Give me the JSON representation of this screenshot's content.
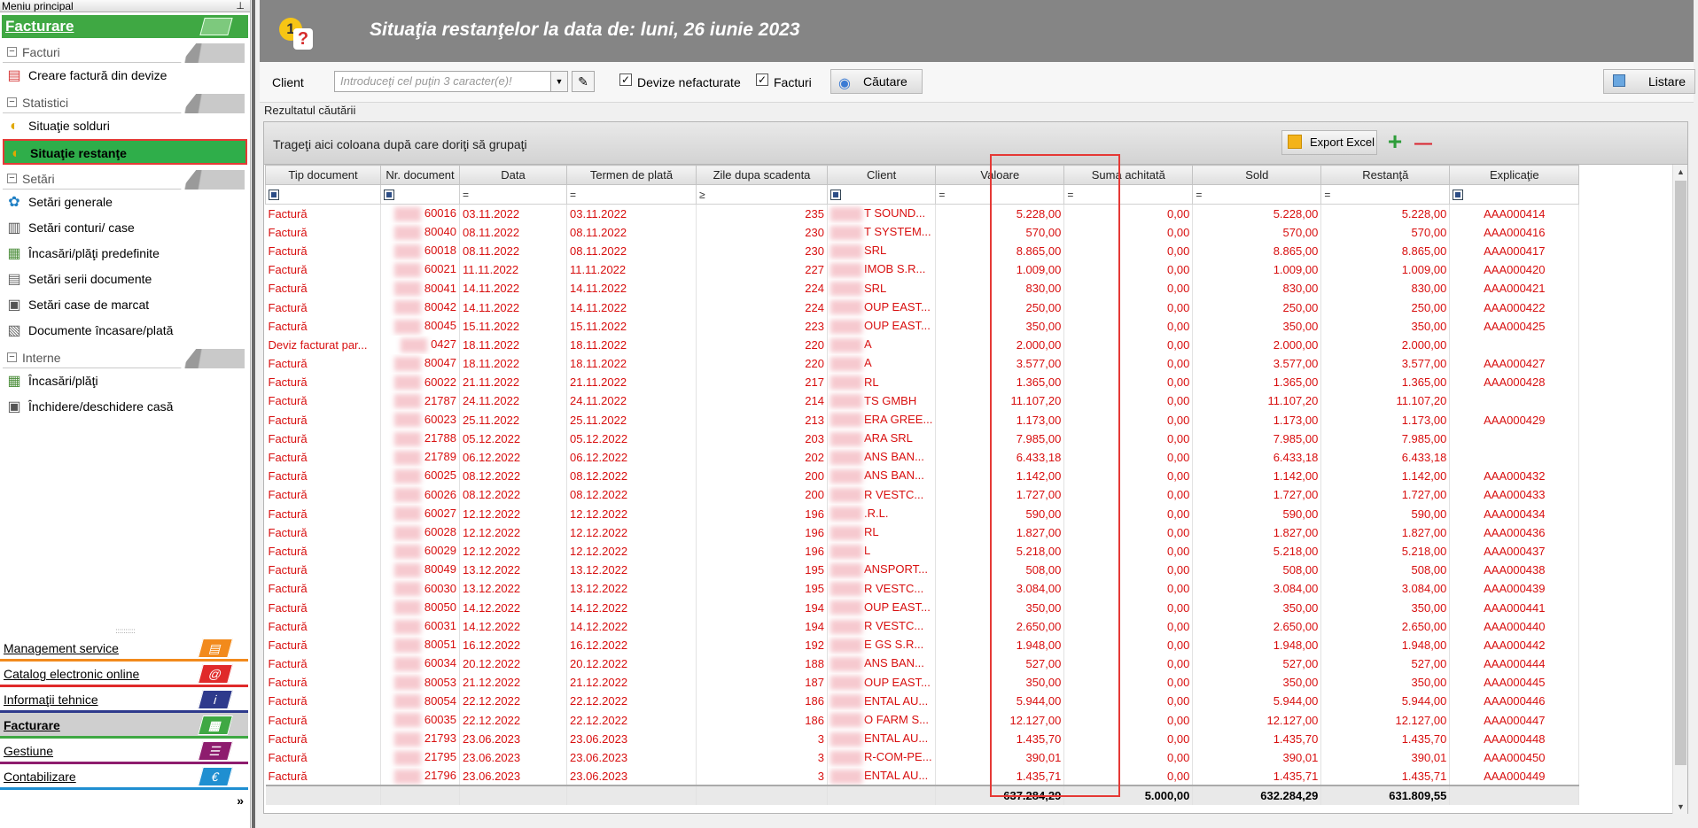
{
  "sidebar": {
    "top_title": "Meniu principal",
    "pin": "⊥",
    "active_module": "Facturare",
    "groups": [
      {
        "label": "Facturi",
        "items": [
          {
            "label": "Creare factură din devize",
            "icon": "invoice-icon"
          }
        ]
      },
      {
        "label": "Statistici",
        "items": [
          {
            "label": "Situaţie solduri",
            "icon": "chart-icon"
          },
          {
            "label": "Situaţie restanţe",
            "icon": "chart-icon",
            "selected": true
          }
        ]
      },
      {
        "label": "Setări",
        "items": [
          {
            "label": "Setări generale",
            "icon": "gear-icon"
          },
          {
            "label": "Setări conturi/ case",
            "icon": "accounts-icon"
          },
          {
            "label": "Încasări/plăţi predefinite",
            "icon": "payments-icon"
          },
          {
            "label": "Setări serii documente",
            "icon": "series-icon"
          },
          {
            "label": "Setări case de marcat",
            "icon": "register-icon"
          },
          {
            "label": "Documente încasare/plată",
            "icon": "document-icon"
          }
        ]
      },
      {
        "label": "Interne",
        "items": [
          {
            "label": "Încasări/plăţi",
            "icon": "payments-icon"
          },
          {
            "label": "Închidere/deschidere casă",
            "icon": "register-icon"
          }
        ]
      }
    ],
    "modules": [
      {
        "label": "Management service",
        "color": "#f28a1c",
        "glyph": "▤"
      },
      {
        "label": "Catalog electronic online",
        "color": "#e02a2a",
        "glyph": "@"
      },
      {
        "label": "Informaţii tehnice",
        "color": "#2e3a8c",
        "glyph": "i"
      },
      {
        "label": "Facturare",
        "color": "#3fa843",
        "glyph": "▦",
        "active": true
      },
      {
        "label": "Gestiune",
        "color": "#8e1c6e",
        "glyph": "☰"
      },
      {
        "label": "Contabilizare",
        "color": "#1f8fd1",
        "glyph": "€"
      }
    ],
    "footer": "»"
  },
  "header": {
    "title": "Situaţia restanţelor la data de: luni, 26 iunie 2023",
    "logo_text_1": "1",
    "logo_text_2": "?"
  },
  "toolbar": {
    "client_label": "Client",
    "client_placeholder": "Introduceţi cel puţin 3 caracter(e)!",
    "devize_label": "Devize nefacturate",
    "facturi_label": "Facturi",
    "search_label": "Căutare",
    "list_label": "Listare"
  },
  "results": {
    "label": "Rezultatul căutării",
    "group_hint": "Trageţi aici coloana după care doriţi să grupaţi",
    "export_label": "Export Excel",
    "add_glyph": "+",
    "remove_glyph": "—"
  },
  "columns": [
    "Tip document",
    "Nr. document",
    "Data",
    "Termen de plată",
    "Zile dupa scadenta",
    "Client",
    "Valoare",
    "Suma achitată",
    "Sold",
    "Restanţă",
    "Explicaţie"
  ],
  "filter_ops": [
    "",
    "",
    "=",
    "=",
    "≥",
    "",
    "=",
    "=",
    "=",
    "=",
    ""
  ],
  "rows": [
    [
      "Factură",
      "60016",
      "03.11.2022",
      "03.11.2022",
      "235",
      "T SOUND...",
      "5.228,00",
      "0,00",
      "5.228,00",
      "5.228,00",
      "AAA000414"
    ],
    [
      "Factură",
      "80040",
      "08.11.2022",
      "08.11.2022",
      "230",
      "T SYSTEM...",
      "570,00",
      "0,00",
      "570,00",
      "570,00",
      "AAA000416"
    ],
    [
      "Factură",
      "60018",
      "08.11.2022",
      "08.11.2022",
      "230",
      "SRL",
      "8.865,00",
      "0,00",
      "8.865,00",
      "8.865,00",
      "AAA000417"
    ],
    [
      "Factură",
      "60021",
      "11.11.2022",
      "11.11.2022",
      "227",
      "IMOB S.R...",
      "1.009,00",
      "0,00",
      "1.009,00",
      "1.009,00",
      "AAA000420"
    ],
    [
      "Factură",
      "80041",
      "14.11.2022",
      "14.11.2022",
      "224",
      "SRL",
      "830,00",
      "0,00",
      "830,00",
      "830,00",
      "AAA000421"
    ],
    [
      "Factură",
      "80042",
      "14.11.2022",
      "14.11.2022",
      "224",
      "OUP EAST...",
      "250,00",
      "0,00",
      "250,00",
      "250,00",
      "AAA000422"
    ],
    [
      "Factură",
      "80045",
      "15.11.2022",
      "15.11.2022",
      "223",
      "OUP EAST...",
      "350,00",
      "0,00",
      "350,00",
      "350,00",
      "AAA000425"
    ],
    [
      "Deviz facturat par...",
      "0427",
      "18.11.2022",
      "18.11.2022",
      "220",
      "A",
      "2.000,00",
      "0,00",
      "2.000,00",
      "2.000,00",
      ""
    ],
    [
      "Factură",
      "80047",
      "18.11.2022",
      "18.11.2022",
      "220",
      "A",
      "3.577,00",
      "0,00",
      "3.577,00",
      "3.577,00",
      "AAA000427"
    ],
    [
      "Factură",
      "60022",
      "21.11.2022",
      "21.11.2022",
      "217",
      "RL",
      "1.365,00",
      "0,00",
      "1.365,00",
      "1.365,00",
      "AAA000428"
    ],
    [
      "Factură",
      "21787",
      "24.11.2022",
      "24.11.2022",
      "214",
      "TS GMBH",
      "11.107,20",
      "0,00",
      "11.107,20",
      "11.107,20",
      ""
    ],
    [
      "Factură",
      "60023",
      "25.11.2022",
      "25.11.2022",
      "213",
      "ERA GREE...",
      "1.173,00",
      "0,00",
      "1.173,00",
      "1.173,00",
      "AAA000429"
    ],
    [
      "Factură",
      "21788",
      "05.12.2022",
      "05.12.2022",
      "203",
      "ARA SRL",
      "7.985,00",
      "0,00",
      "7.985,00",
      "7.985,00",
      ""
    ],
    [
      "Factură",
      "21789",
      "06.12.2022",
      "06.12.2022",
      "202",
      "ANS BAN...",
      "6.433,18",
      "0,00",
      "6.433,18",
      "6.433,18",
      ""
    ],
    [
      "Factură",
      "60025",
      "08.12.2022",
      "08.12.2022",
      "200",
      "ANS BAN...",
      "1.142,00",
      "0,00",
      "1.142,00",
      "1.142,00",
      "AAA000432"
    ],
    [
      "Factură",
      "60026",
      "08.12.2022",
      "08.12.2022",
      "200",
      "R VESTC...",
      "1.727,00",
      "0,00",
      "1.727,00",
      "1.727,00",
      "AAA000433"
    ],
    [
      "Factură",
      "60027",
      "12.12.2022",
      "12.12.2022",
      "196",
      ".R.L.",
      "590,00",
      "0,00",
      "590,00",
      "590,00",
      "AAA000434"
    ],
    [
      "Factură",
      "60028",
      "12.12.2022",
      "12.12.2022",
      "196",
      "RL",
      "1.827,00",
      "0,00",
      "1.827,00",
      "1.827,00",
      "AAA000436"
    ],
    [
      "Factură",
      "60029",
      "12.12.2022",
      "12.12.2022",
      "196",
      "L",
      "5.218,00",
      "0,00",
      "5.218,00",
      "5.218,00",
      "AAA000437"
    ],
    [
      "Factură",
      "80049",
      "13.12.2022",
      "13.12.2022",
      "195",
      "ANSPORT...",
      "508,00",
      "0,00",
      "508,00",
      "508,00",
      "AAA000438"
    ],
    [
      "Factură",
      "60030",
      "13.12.2022",
      "13.12.2022",
      "195",
      "R VESTC...",
      "3.084,00",
      "0,00",
      "3.084,00",
      "3.084,00",
      "AAA000439"
    ],
    [
      "Factură",
      "80050",
      "14.12.2022",
      "14.12.2022",
      "194",
      "OUP EAST...",
      "350,00",
      "0,00",
      "350,00",
      "350,00",
      "AAA000441"
    ],
    [
      "Factură",
      "60031",
      "14.12.2022",
      "14.12.2022",
      "194",
      "R VESTC...",
      "2.650,00",
      "0,00",
      "2.650,00",
      "2.650,00",
      "AAA000440"
    ],
    [
      "Factură",
      "80051",
      "16.12.2022",
      "16.12.2022",
      "192",
      "E GS S.R...",
      "1.948,00",
      "0,00",
      "1.948,00",
      "1.948,00",
      "AAA000442"
    ],
    [
      "Factură",
      "60034",
      "20.12.2022",
      "20.12.2022",
      "188",
      "ANS BAN...",
      "527,00",
      "0,00",
      "527,00",
      "527,00",
      "AAA000444"
    ],
    [
      "Factură",
      "80053",
      "21.12.2022",
      "21.12.2022",
      "187",
      "OUP EAST...",
      "350,00",
      "0,00",
      "350,00",
      "350,00",
      "AAA000445"
    ],
    [
      "Factură",
      "80054",
      "22.12.2022",
      "22.12.2022",
      "186",
      "ENTAL AU...",
      "5.944,00",
      "0,00",
      "5.944,00",
      "5.944,00",
      "AAA000446"
    ],
    [
      "Factură",
      "60035",
      "22.12.2022",
      "22.12.2022",
      "186",
      "O FARM S...",
      "12.127,00",
      "0,00",
      "12.127,00",
      "12.127,00",
      "AAA000447"
    ],
    [
      "Factură",
      "21793",
      "23.06.2023",
      "23.06.2023",
      "3",
      "ENTAL AU...",
      "1.435,70",
      "0,00",
      "1.435,70",
      "1.435,70",
      "AAA000448"
    ],
    [
      "Factură",
      "21795",
      "23.06.2023",
      "23.06.2023",
      "3",
      "R-COM-PE...",
      "390,01",
      "0,00",
      "390,01",
      "390,01",
      "AAA000450"
    ],
    [
      "Factură",
      "21796",
      "23.06.2023",
      "23.06.2023",
      "3",
      "ENTAL AU...",
      "1.435,71",
      "0,00",
      "1.435,71",
      "1.435,71",
      "AAA000449"
    ]
  ],
  "totals": {
    "valoare": "637.284,29",
    "suma_achitata": "5.000,00",
    "sold": "632.284,29",
    "restanta": "631.809,55"
  },
  "colors": {
    "active_green": "#3fa843",
    "row_text": "#d80f0f",
    "highlight": "#e53935",
    "header_bg": "#858585"
  }
}
